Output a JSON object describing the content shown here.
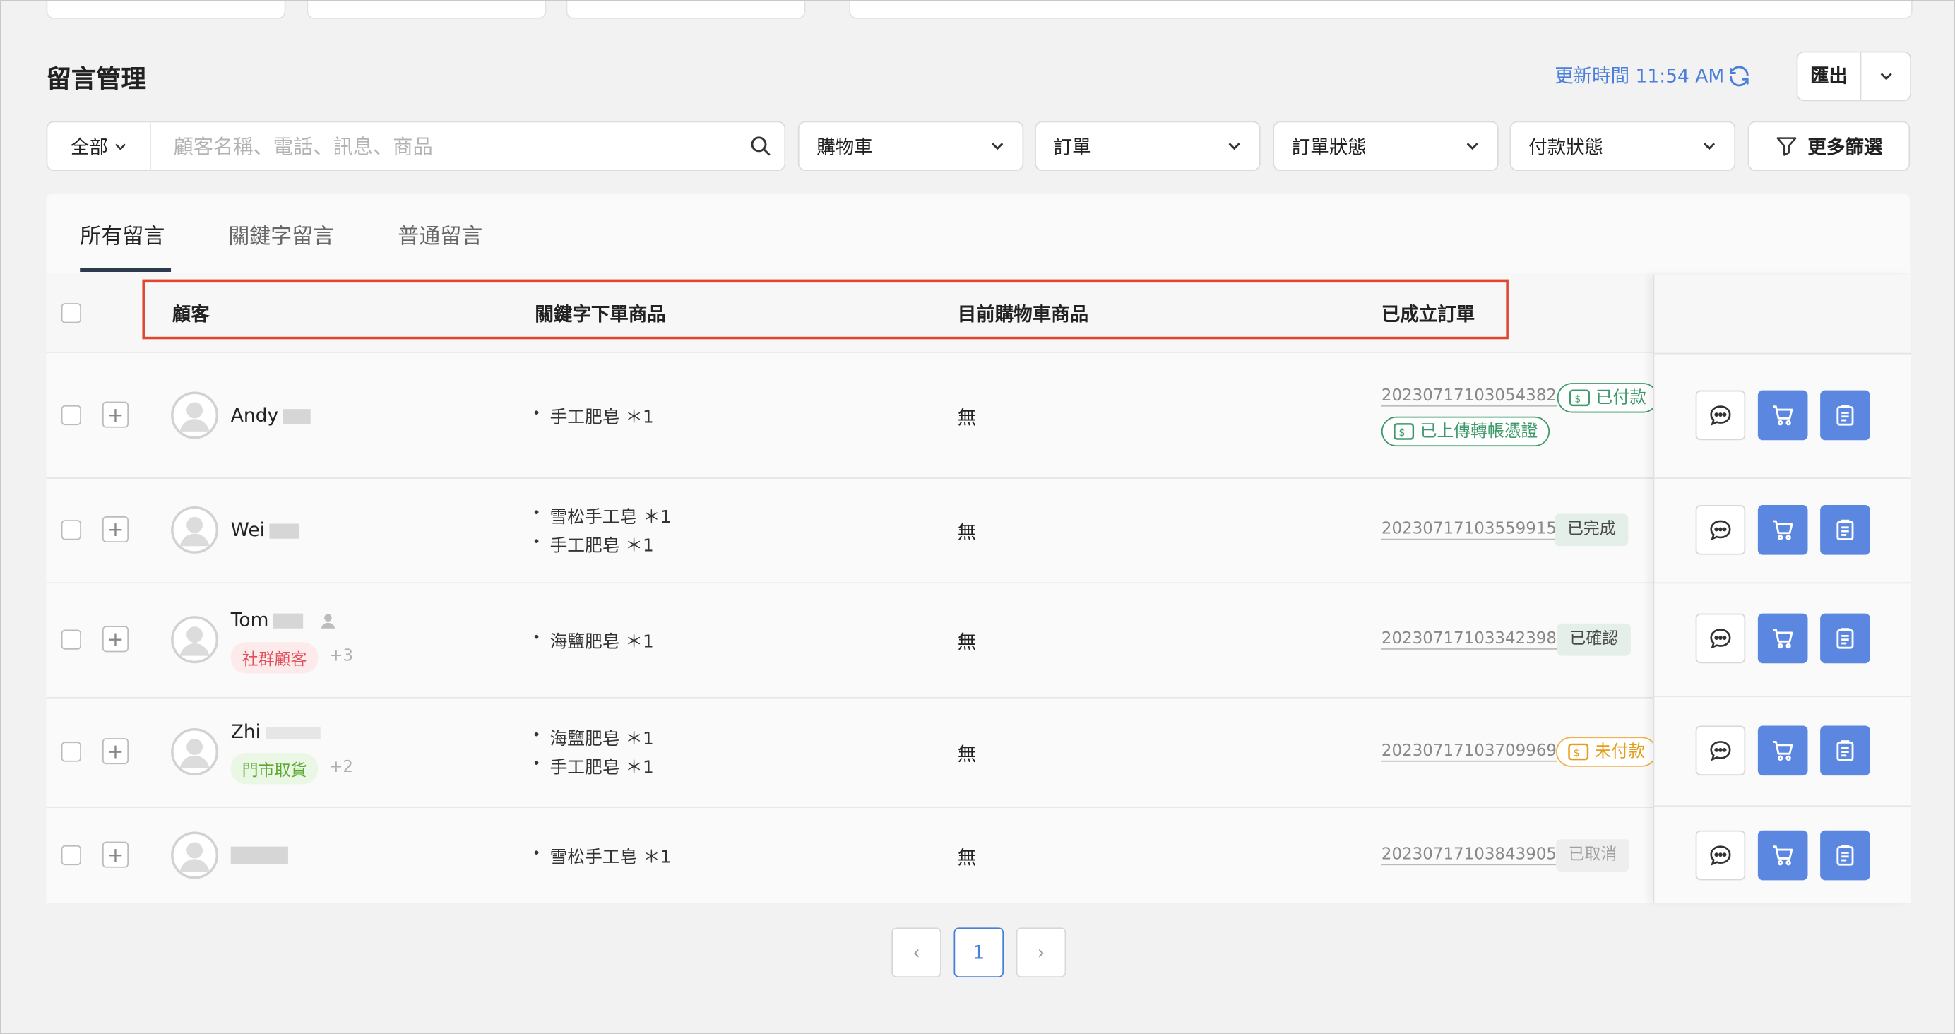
{
  "header": {
    "title": "留言管理",
    "updated_label": "更新時間 11:54 AM",
    "export_label": "匯出"
  },
  "filters": {
    "scope": "全部",
    "search_placeholder": "顧客名稱、電話、訊息、商品",
    "dropdowns": [
      "購物車",
      "訂單",
      "訂單狀態",
      "付款狀態"
    ],
    "more_label": "更多篩選"
  },
  "tabs": [
    "所有留言",
    "關鍵字留言",
    "普通留言"
  ],
  "table": {
    "columns": [
      "顧客",
      "關鍵字下單商品",
      "目前購物車商品",
      "已成立訂單"
    ],
    "rows": [
      {
        "name": "Andy",
        "tag": "",
        "tag_more": "",
        "items": [
          "手工肥皂 ＊1"
        ],
        "cart": "無",
        "order_no": "20230717103054382",
        "statuses": [
          "已付款",
          "已上傳轉帳憑證"
        ]
      },
      {
        "name": "Wei",
        "tag": "",
        "tag_more": "",
        "items": [
          "雪松手工皂 ＊1",
          "手工肥皂 ＊1"
        ],
        "cart": "無",
        "order_no": "20230717103559915",
        "statuses": [
          "已完成"
        ]
      },
      {
        "name": "Tom",
        "tag": "社群顧客",
        "tag_more": "+3",
        "items": [
          "海鹽肥皂 ＊1"
        ],
        "cart": "無",
        "order_no": "20230717103342398",
        "statuses": [
          "已確認"
        ]
      },
      {
        "name": "Zhi",
        "tag": "門市取貨",
        "tag_more": "+2",
        "items": [
          "海鹽肥皂 ＊1",
          "手工肥皂 ＊1"
        ],
        "cart": "無",
        "order_no": "20230717103709969",
        "statuses": [
          "未付款"
        ]
      },
      {
        "name": "",
        "tag": "",
        "tag_more": "",
        "items": [
          "雪松手工皂 ＊1"
        ],
        "cart": "無",
        "order_no": "20230717103843905",
        "statuses": [
          "已取消"
        ]
      }
    ]
  },
  "pagination": {
    "current": "1",
    "prev": "‹",
    "next": "›"
  },
  "colors": {
    "accent": "#5b87e0",
    "link": "#4a7fd9",
    "highlight": "#e0462e",
    "paid": "#3e9a6a",
    "unpaid": "#e59d20"
  }
}
